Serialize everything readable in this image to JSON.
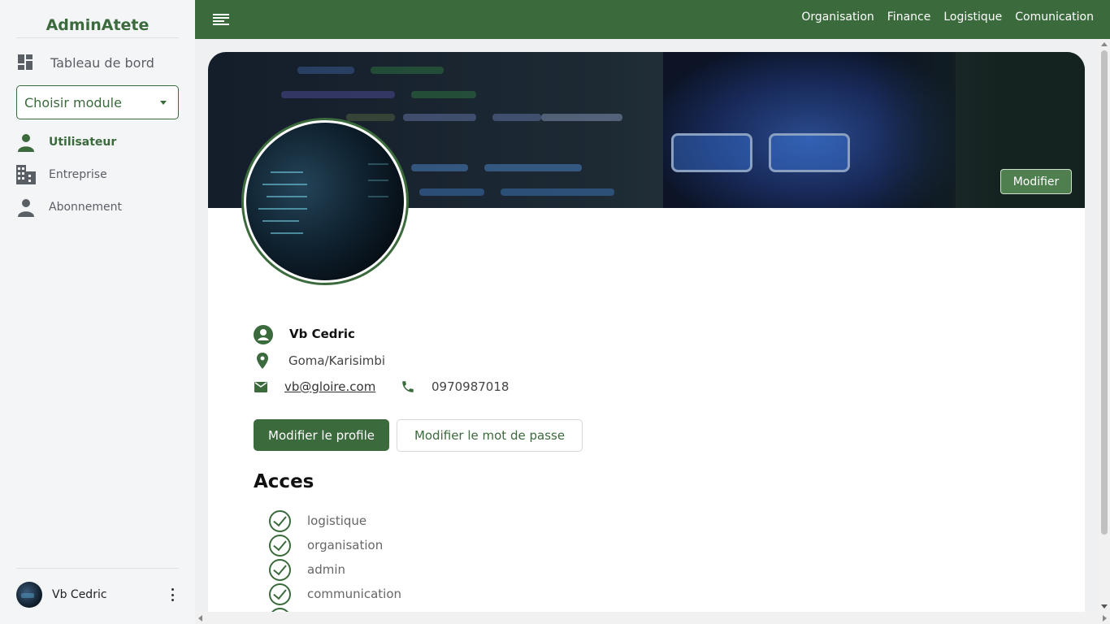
{
  "brand": {
    "title": "AdminAtete"
  },
  "sidebar": {
    "dashboard_label": "Tableau de bord",
    "module_select_value": "Choisir module",
    "items": [
      {
        "label": "Utilisateur",
        "icon": "person-icon",
        "active": true
      },
      {
        "label": "Entreprise",
        "icon": "building-icon",
        "active": false
      },
      {
        "label": "Abonnement",
        "icon": "person-icon",
        "active": false
      }
    ],
    "footer_user_name": "Vb Cedric"
  },
  "topbar": {
    "nav": [
      "Organisation",
      "Finance",
      "Logistique",
      "Comunication"
    ]
  },
  "profile": {
    "cover_button": "Modifier",
    "name": "Vb Cedric",
    "location": "Goma/Karisimbi",
    "email": "vb@gloire.com",
    "phone": "0970987018",
    "edit_profile_button": "Modifier le profile",
    "edit_password_button": "Modifier le mot de passe"
  },
  "acces": {
    "title": "Acces",
    "items": [
      "logistique",
      "organisation",
      "admin",
      "communication"
    ]
  },
  "colors": {
    "primary": "#3b6a3c",
    "sidebar_bg": "#f4f5f7",
    "content_bg": "#eef0f2"
  }
}
